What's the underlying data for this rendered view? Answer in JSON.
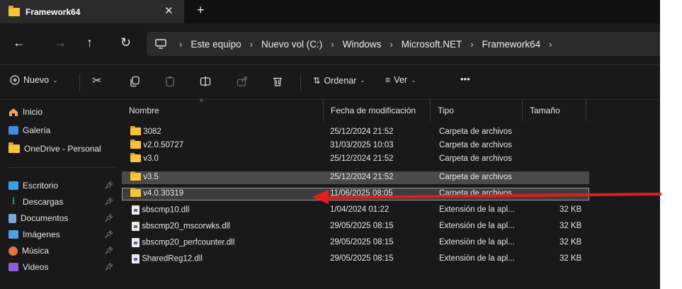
{
  "tab": {
    "title": "Framework64",
    "close": "✕",
    "new": "+"
  },
  "nav": {
    "back": "←",
    "forward": "→",
    "up": "↑",
    "refresh": "↻"
  },
  "breadcrumb": [
    {
      "label": "Este equipo"
    },
    {
      "label": "Nuevo vol (C:)"
    },
    {
      "label": "Windows"
    },
    {
      "label": "Microsoft.NET"
    },
    {
      "label": "Framework64"
    }
  ],
  "breadcrumb_sep": "›",
  "toolbar": {
    "new_label": "Nuevo",
    "sort_label": "Ordenar",
    "view_label": "Ver",
    "more": "•••"
  },
  "sidebar": {
    "items": [
      {
        "label": "Inicio"
      },
      {
        "label": "Galería"
      },
      {
        "label": "OneDrive - Personal"
      },
      {
        "label": "Escritorio"
      },
      {
        "label": "Descargas"
      },
      {
        "label": "Documentos"
      },
      {
        "label": "Imágenes"
      },
      {
        "label": "Música"
      },
      {
        "label": "Videos"
      }
    ]
  },
  "columns": {
    "name": "Nombre",
    "date": "Fecha de modificación",
    "type": "Tipo",
    "size": "Tamaño"
  },
  "files": [
    {
      "name": "3082",
      "date": "25/12/2024 21:52",
      "type": "Carpeta de archivos",
      "size": ""
    },
    {
      "name": "v2.0.50727",
      "date": "31/03/2025 10:03",
      "type": "Carpeta de archivos",
      "size": ""
    },
    {
      "name": "v3.0",
      "date": "25/12/2024 21:52",
      "type": "Carpeta de archivos",
      "size": ""
    },
    {
      "name": "v3.5",
      "date": "25/12/2024 21:52",
      "type": "Carpeta de archivos",
      "size": ""
    },
    {
      "name": "v4.0.30319",
      "date": "11/06/2025 08:05",
      "type": "Carpeta de archivos",
      "size": ""
    },
    {
      "name": "sbscmp10.dll",
      "date": "1/04/2024 01:22",
      "type": "Extensión de la apl...",
      "size": "32 KB"
    },
    {
      "name": "sbscmp20_mscorwks.dll",
      "date": "29/05/2025 08:15",
      "type": "Extensión de la apl...",
      "size": "32 KB"
    },
    {
      "name": "sbscmp20_perfcounter.dll",
      "date": "29/05/2025 08:15",
      "type": "Extensión de la apl...",
      "size": "32 KB"
    },
    {
      "name": "SharedReg12.dll",
      "date": "29/05/2025 08:15",
      "type": "Extensión de la apl...",
      "size": "32 KB"
    }
  ],
  "colors": {
    "window_bg": "#191919",
    "folder": "#f6c33b",
    "annotation_arrow": "#e11d1d"
  }
}
